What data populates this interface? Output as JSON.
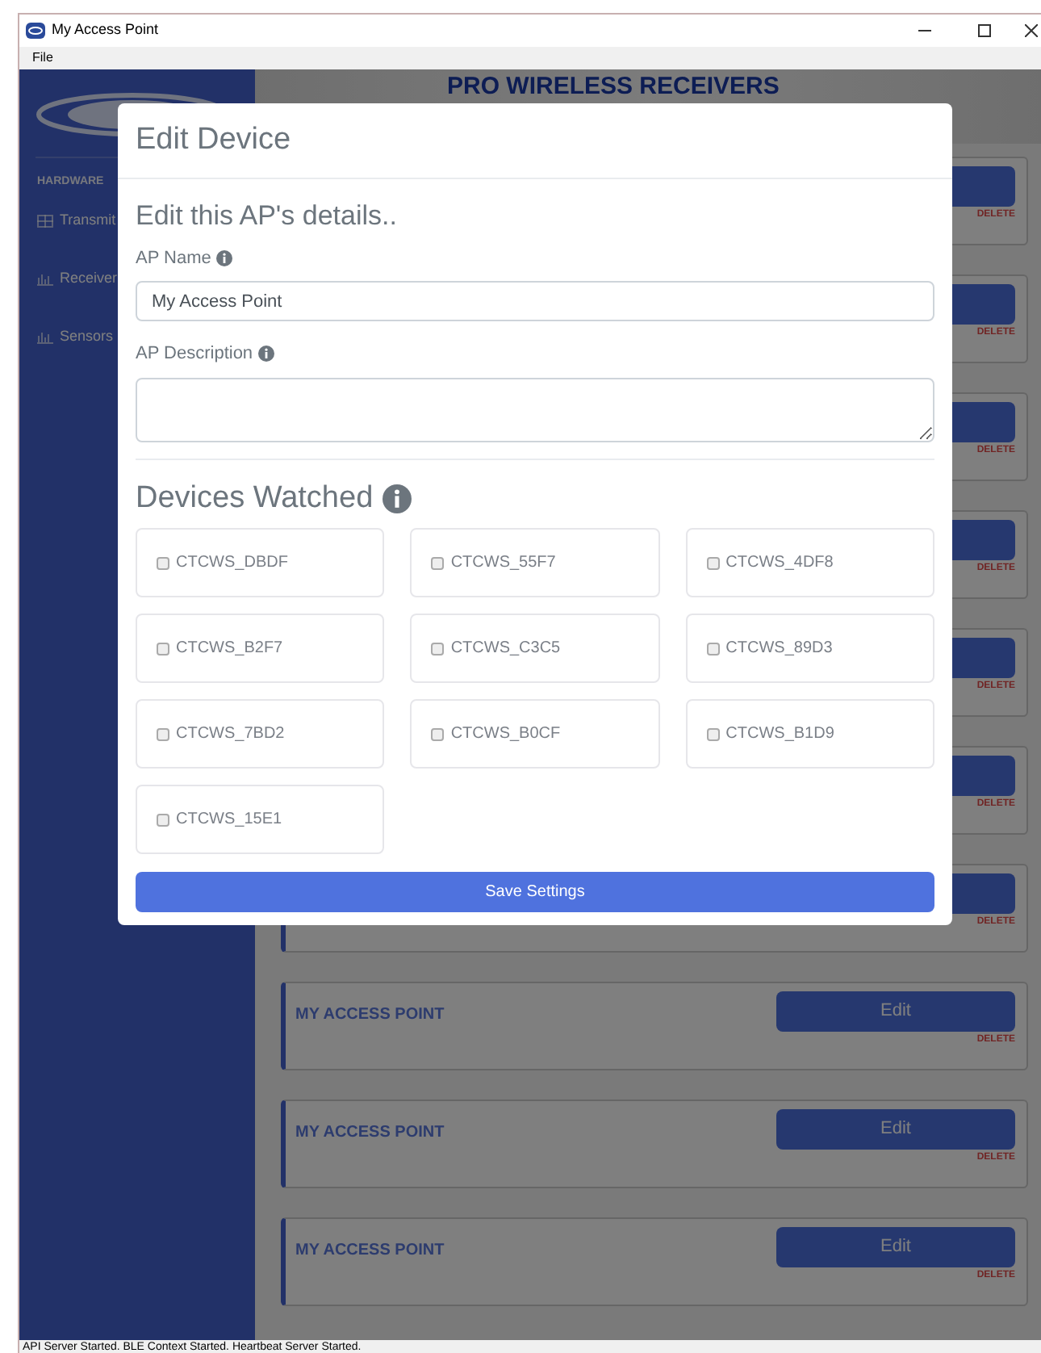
{
  "window": {
    "title": "My Access Point"
  },
  "menu": [
    "File"
  ],
  "header": {
    "title": "PRO WIRELESS RECEIVERS"
  },
  "sidebar": {
    "section": "HARDWARE",
    "items": [
      {
        "label": "Transmit",
        "kind": "table"
      },
      {
        "label": "Receiver",
        "kind": "chart"
      },
      {
        "label": "Sensors",
        "kind": "chart"
      }
    ]
  },
  "cards": [
    {
      "delete": "DELETE"
    },
    {
      "delete": "DELETE"
    },
    {
      "delete": "DELETE"
    },
    {
      "delete": "DELETE"
    },
    {
      "delete": "DELETE"
    },
    {
      "delete": "DELETE"
    },
    {
      "delete": "DELETE"
    },
    {
      "title": "MY ACCESS POINT",
      "edit": "Edit",
      "delete": "DELETE"
    },
    {
      "title": "MY ACCESS POINT",
      "edit": "Edit",
      "delete": "DELETE"
    },
    {
      "title": "MY ACCESS POINT",
      "edit": "Edit",
      "delete": "DELETE"
    }
  ],
  "modal": {
    "title": "Edit Device",
    "subtitle": "Edit this AP's details..",
    "name_label": "AP Name",
    "name_value": "My Access Point",
    "description_label": "AP Description",
    "devices_title": "Devices Watched",
    "devices": [
      {
        "label": "CTCWS_DBDF",
        "checked": false
      },
      {
        "label": "CTCWS_55F7",
        "checked": false
      },
      {
        "label": "CTCWS_4DF8",
        "checked": false
      },
      {
        "label": "CTCWS_B2F7",
        "checked": false
      },
      {
        "label": "CTCWS_C3C5",
        "checked": false
      },
      {
        "label": "CTCWS_89D3",
        "checked": false
      },
      {
        "label": "CTCWS_7BD2",
        "checked": false
      },
      {
        "label": "CTCWS_B0CF",
        "checked": false
      },
      {
        "label": "CTCWS_B1D9",
        "checked": false
      },
      {
        "label": "CTCWS_15E1",
        "checked": false
      }
    ],
    "save": "Save Settings"
  },
  "status_bar": "API Server Started.  BLE Context Started.  Heartbeat Server Started."
}
